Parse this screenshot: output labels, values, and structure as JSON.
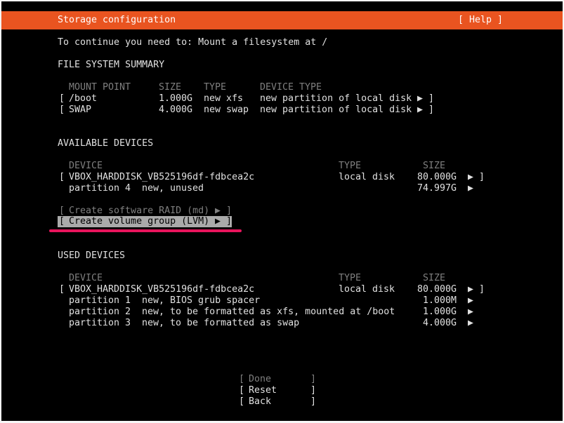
{
  "header": {
    "title": "Storage configuration",
    "help": "[ Help ]"
  },
  "instruction": "To continue you need to: Mount a filesystem at /",
  "fs_summary": {
    "heading": "FILE SYSTEM SUMMARY",
    "columns": {
      "mount_point": "MOUNT POINT",
      "size": "SIZE",
      "type": "TYPE",
      "device_type": "DEVICE TYPE"
    },
    "rows": [
      {
        "mount": "/boot",
        "size": "1.000G",
        "type": "new xfs",
        "device_type": "new partition of local disk"
      },
      {
        "mount": "SWAP",
        "size": "4.000G",
        "type": "new swap",
        "device_type": "new partition of local disk"
      }
    ]
  },
  "available": {
    "heading": "AVAILABLE DEVICES",
    "columns": {
      "device": "DEVICE",
      "type": "TYPE",
      "size": "SIZE"
    },
    "disk": {
      "name": "VBOX_HARDDISK_VB525196df-fdbcea2c",
      "type": "local disk",
      "size": "80.000G"
    },
    "partition": {
      "label": "partition 4",
      "desc": "new, unused",
      "size": "74.997G"
    },
    "create_raid": "Create software RAID (md)",
    "create_lvm": "Create volume group (LVM)"
  },
  "used": {
    "heading": "USED DEVICES",
    "columns": {
      "device": "DEVICE",
      "type": "TYPE",
      "size": "SIZE"
    },
    "disk": {
      "name": "VBOX_HARDDISK_VB525196df-fdbcea2c",
      "type": "local disk",
      "size": "80.000G"
    },
    "partitions": [
      {
        "label": "partition 1",
        "desc": "new, BIOS grub spacer",
        "size": "1.000M"
      },
      {
        "label": "partition 2",
        "desc": "new, to be formatted as xfs, mounted at /boot",
        "size": "1.000G"
      },
      {
        "label": "partition 3",
        "desc": "new, to be formatted as swap",
        "size": "4.000G"
      }
    ]
  },
  "buttons": {
    "done": "Done",
    "reset": "Reset",
    "back": "Back"
  },
  "glyphs": {
    "arrow": "▶",
    "open": "[",
    "close": "]"
  },
  "colors": {
    "title_bar": "#e95420",
    "underline_mark": "#e8145c",
    "selected_bg": "#aaaaaa"
  }
}
